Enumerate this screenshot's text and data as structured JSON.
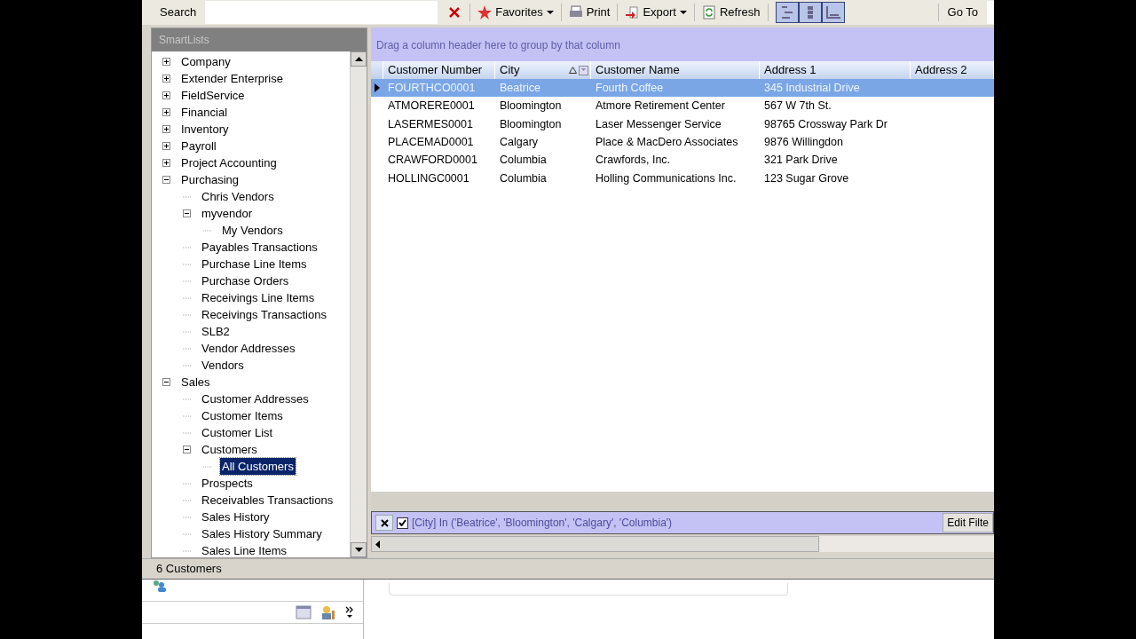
{
  "toolbar": {
    "search_label": "Search",
    "buttons": [
      {
        "kind": "clear"
      },
      {
        "kind": "favorites",
        "label": "Favorites",
        "dropdown": true
      },
      {
        "kind": "print",
        "label": "Print",
        "dropdown": false
      },
      {
        "kind": "export",
        "label": "Export",
        "dropdown": true
      },
      {
        "kind": "refresh",
        "label": "Refresh",
        "dropdown": false
      }
    ],
    "views": [
      {
        "kind": "tree",
        "selected": true
      },
      {
        "kind": "list",
        "selected": true
      },
      {
        "kind": "bottom",
        "selected": true
      }
    ],
    "goto_label": "Go To"
  },
  "sidebar": {
    "title": "SmartLists",
    "tree": [
      {
        "label": "Company",
        "kind": "folder",
        "expanded": false,
        "selected": false
      },
      {
        "label": "Extender Enterprise",
        "kind": "folder",
        "expanded": false,
        "selected": false
      },
      {
        "label": "FieldService",
        "kind": "folder",
        "expanded": false,
        "selected": false
      },
      {
        "label": "Financial",
        "kind": "folder",
        "expanded": false,
        "selected": false
      },
      {
        "label": "Inventory",
        "kind": "folder",
        "expanded": false,
        "selected": false
      },
      {
        "label": "Payroll",
        "kind": "folder",
        "expanded": false,
        "selected": false
      },
      {
        "label": "Project Accounting",
        "kind": "folder",
        "expanded": false,
        "selected": false
      },
      {
        "label": "Purchasing",
        "kind": "folder",
        "expanded": true,
        "selected": false,
        "children": [
          {
            "label": "Chris Vendors",
            "kind": "leaf",
            "selected": false
          },
          {
            "label": "myvendor",
            "kind": "folder",
            "expanded": true,
            "selected": false,
            "children": [
              {
                "label": "My Vendors",
                "kind": "leaf",
                "selected": false
              }
            ]
          },
          {
            "label": "Payables Transactions",
            "kind": "leaf",
            "selected": false
          },
          {
            "label": "Purchase Line Items",
            "kind": "leaf",
            "selected": false
          },
          {
            "label": "Purchase Orders",
            "kind": "leaf",
            "selected": false
          },
          {
            "label": "Receivings Line Items",
            "kind": "leaf",
            "selected": false
          },
          {
            "label": "Receivings Transactions",
            "kind": "leaf",
            "selected": false
          },
          {
            "label": "SLB2",
            "kind": "leaf",
            "selected": false
          },
          {
            "label": "Vendor Addresses",
            "kind": "leaf",
            "selected": false
          },
          {
            "label": "Vendors",
            "kind": "leaf",
            "selected": false
          }
        ]
      },
      {
        "label": "Sales",
        "kind": "folder",
        "expanded": true,
        "selected": false,
        "children": [
          {
            "label": "Customer Addresses",
            "kind": "leaf",
            "selected": false
          },
          {
            "label": "Customer Items",
            "kind": "leaf",
            "selected": false
          },
          {
            "label": "Customer List",
            "kind": "leaf",
            "selected": false
          },
          {
            "label": "Customers",
            "kind": "folder",
            "expanded": true,
            "selected": false,
            "children": [
              {
                "label": "All Customers",
                "kind": "leaf",
                "selected": true
              }
            ]
          },
          {
            "label": "Prospects",
            "kind": "leaf",
            "selected": false
          },
          {
            "label": "Receivables Transactions",
            "kind": "leaf",
            "selected": false
          },
          {
            "label": "Sales History",
            "kind": "leaf",
            "selected": false
          },
          {
            "label": "Sales History Summary",
            "kind": "leaf",
            "selected": false
          },
          {
            "label": "Sales Line Items",
            "kind": "leaf",
            "selected": false
          }
        ]
      }
    ]
  },
  "grid": {
    "group_hint": "Drag a column header here to group by that column",
    "columns": [
      {
        "label": "Customer Number",
        "sorted": false,
        "filtered": false
      },
      {
        "label": "City",
        "sorted": true,
        "filtered": true
      },
      {
        "label": "Customer Name",
        "sorted": false,
        "filtered": false
      },
      {
        "label": "Address 1",
        "sorted": false,
        "filtered": false
      },
      {
        "label": "Address 2",
        "sorted": false,
        "filtered": false
      }
    ],
    "rows": [
      {
        "cells": [
          "FOURTHCO0001",
          "Beatrice",
          "Fourth Coffee",
          "345 Industrial Drive"
        ],
        "selected": true
      },
      {
        "cells": [
          "ATMORERE0001",
          "Bloomington",
          "Atmore Retirement Center",
          "567 W 7th St."
        ],
        "selected": false
      },
      {
        "cells": [
          "LASERMES0001",
          "Bloomington",
          "Laser Messenger Service",
          "98765 Crossway Park Dr"
        ],
        "selected": false
      },
      {
        "cells": [
          "PLACEMAD0001",
          "Calgary",
          "Place & MacDero Associates",
          "9876 Willingdon"
        ],
        "selected": false
      },
      {
        "cells": [
          "CRAWFORD0001",
          "Columbia",
          "Crawfords, Inc.",
          "321 Park Drive"
        ],
        "selected": false
      },
      {
        "cells": [
          "HOLLINGC0001",
          "Columbia",
          "Holling Communications Inc.",
          "123 Sugar Grove"
        ],
        "selected": false
      }
    ],
    "filter": {
      "checked": true,
      "text": "[City] In ('Beatrice', 'Bloomington', 'Calgary', 'Columbia')",
      "edit_label": "Edit Filte"
    }
  },
  "status_bar": "6 Customers"
}
